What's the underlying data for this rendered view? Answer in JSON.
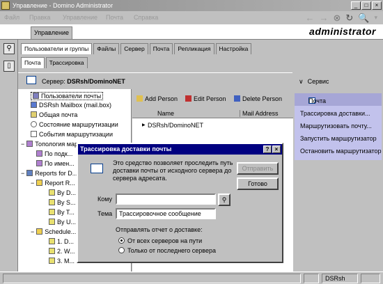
{
  "window": {
    "title": "Управление - Domino Administrator"
  },
  "menu": [
    "Файл",
    "Правка",
    "Управление",
    "Почта",
    "Справка"
  ],
  "header": {
    "admin_tab": "Управление",
    "user_name": "administrator"
  },
  "main_tabs": [
    "Пользователи и группы",
    "Файлы",
    "Сервер",
    "Почта",
    "Репликация",
    "Настройка"
  ],
  "sub_tabs": [
    "Почта",
    "Трассировка"
  ],
  "server_bar": {
    "label": "Сервер:",
    "server_name": "DSRsh/DominoNET"
  },
  "tree": [
    "Пользователи почты",
    "DSRsh Mailbox (mail.box)",
    "Общая почта",
    "Состояние маршрутизации",
    "События маршрутизации",
    "Топология маршрутизации",
    "По подк...",
    "По имен...",
    "Reports for D...",
    "Report R...",
    "By D...",
    "By S...",
    "By T...",
    "By U...",
    "Schedule...",
    "1. D...",
    "2. W...",
    "3. M..."
  ],
  "actions": {
    "add_person": "Add Person",
    "edit_person": "Edit Person",
    "delete_person": "Delete Person"
  },
  "table": {
    "headers": [
      "Name",
      "Mail Address"
    ],
    "rows": [
      [
        "DSRsh/DominoNET",
        ""
      ]
    ]
  },
  "right_panel": {
    "service_label": "Сервис",
    "section_title": "Почта",
    "items": [
      "Трассировка доставки...",
      "Маршрутизовать почту...",
      "Запустить маршрутизатор",
      "Остановить маршрутизатор"
    ]
  },
  "dialog": {
    "title": "Трассировка доставки почты",
    "description": "Это средство позволяет проследить путь доставки почты от исходного сервера до сервера адресата.",
    "send_button": "Отправить",
    "done_button": "Готово",
    "to_label": "Кому",
    "to_value": "",
    "subject_label": "Тема",
    "subject_value": "Трассировочное сообщение",
    "report_label": "Отправлять отчет о доставке:",
    "options": [
      "От всех серверов на пути",
      "Только от последнего сервера"
    ],
    "selected_option": 0
  },
  "status": {
    "server": "DSRsh"
  }
}
